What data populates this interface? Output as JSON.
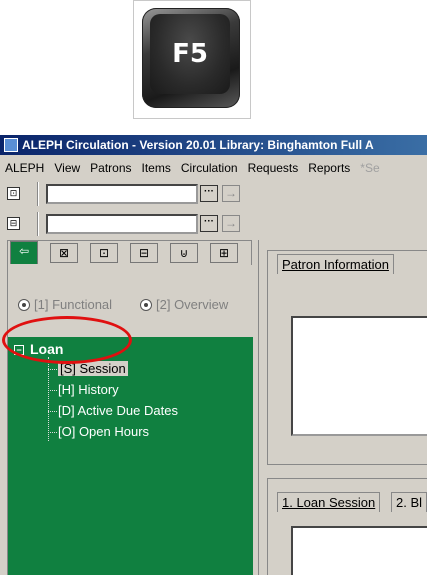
{
  "key_image": {
    "label": "F5"
  },
  "window": {
    "title": "ALEPH Circulation - Version 20.01  Library:  Binghamton Full A"
  },
  "menu": {
    "items": [
      "ALEPH",
      "View",
      "Patrons",
      "Items",
      "Circulation",
      "Requests",
      "Reports",
      "*Se"
    ]
  },
  "toolbar": {
    "rows": [
      {
        "icon": "patron-icon",
        "input_value": "",
        "dots_label": "···",
        "arrow_label": "→"
      },
      {
        "icon": "item-icon",
        "input_value": "",
        "dots_label": "···",
        "arrow_label": "→"
      }
    ]
  },
  "left_panel": {
    "tabs": [
      "⇦",
      "⊠",
      "⊡",
      "⊟",
      "⊍",
      "⊞"
    ],
    "options": {
      "functional": "[1] Functional",
      "overview": "[2] Overview"
    },
    "tree": {
      "root": "Loan",
      "expander": "−",
      "children": [
        {
          "label": "[S] Session",
          "selected": true
        },
        {
          "label": "[H] History",
          "selected": false
        },
        {
          "label": "[D] Active Due Dates",
          "selected": false
        },
        {
          "label": "[O] Open Hours",
          "selected": false
        }
      ]
    }
  },
  "right_panel": {
    "top_tab": "Patron Information",
    "bottom_tabs": [
      "1. Loan Session",
      "2. Bl"
    ]
  },
  "colors": {
    "tree_bg": "#108040",
    "title_bar": "#0a246a",
    "highlight_oval": "#e01010",
    "window_bg": "#d4d0c8"
  }
}
